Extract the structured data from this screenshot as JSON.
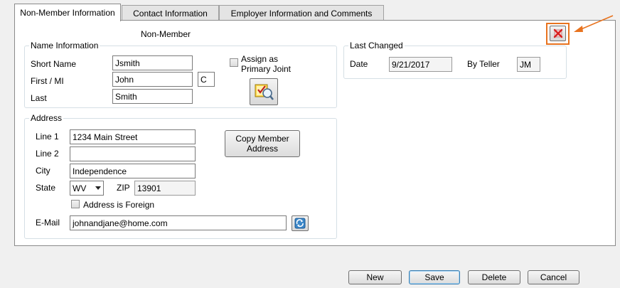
{
  "tabs": [
    {
      "label": "Non-Member Information"
    },
    {
      "label": "Contact Information"
    },
    {
      "label": "Employer Information and Comments"
    }
  ],
  "form": {
    "heading": "Non-Member",
    "name_info": {
      "legend": "Name Information",
      "short_name_label": "Short Name",
      "short_name": "Jsmith",
      "first_mi_label": "First / MI",
      "first": "John",
      "mi": "C",
      "last_label": "Last",
      "last": "Smith",
      "assign_primary_joint": "Assign as Primary Joint"
    },
    "address": {
      "legend": "Address",
      "line1_label": "Line 1",
      "line1": "1234 Main Street",
      "line2_label": "Line 2",
      "line2": "",
      "city_label": "City",
      "city": "Independence",
      "state_label": "State",
      "state": "WV",
      "zip_label": "ZIP",
      "zip": "13901",
      "foreign_label": "Address is Foreign",
      "email_label": "E-Mail",
      "email": "johnandjane@home.com",
      "copy_button": "Copy Member Address"
    },
    "last_changed": {
      "legend": "Last Changed",
      "date_label": "Date",
      "date": "9/21/2017",
      "teller_label": "By Teller",
      "teller": "JM"
    }
  },
  "buttons": {
    "new": "New",
    "save": "Save",
    "delete": "Delete",
    "cancel": "Cancel"
  },
  "icons": {
    "delete_record": "delete-record-icon",
    "lookup": "lookup-icon",
    "email_refresh": "email-refresh-icon"
  },
  "colors": {
    "highlight": "#e8731f",
    "delete_x": "#d92020"
  }
}
